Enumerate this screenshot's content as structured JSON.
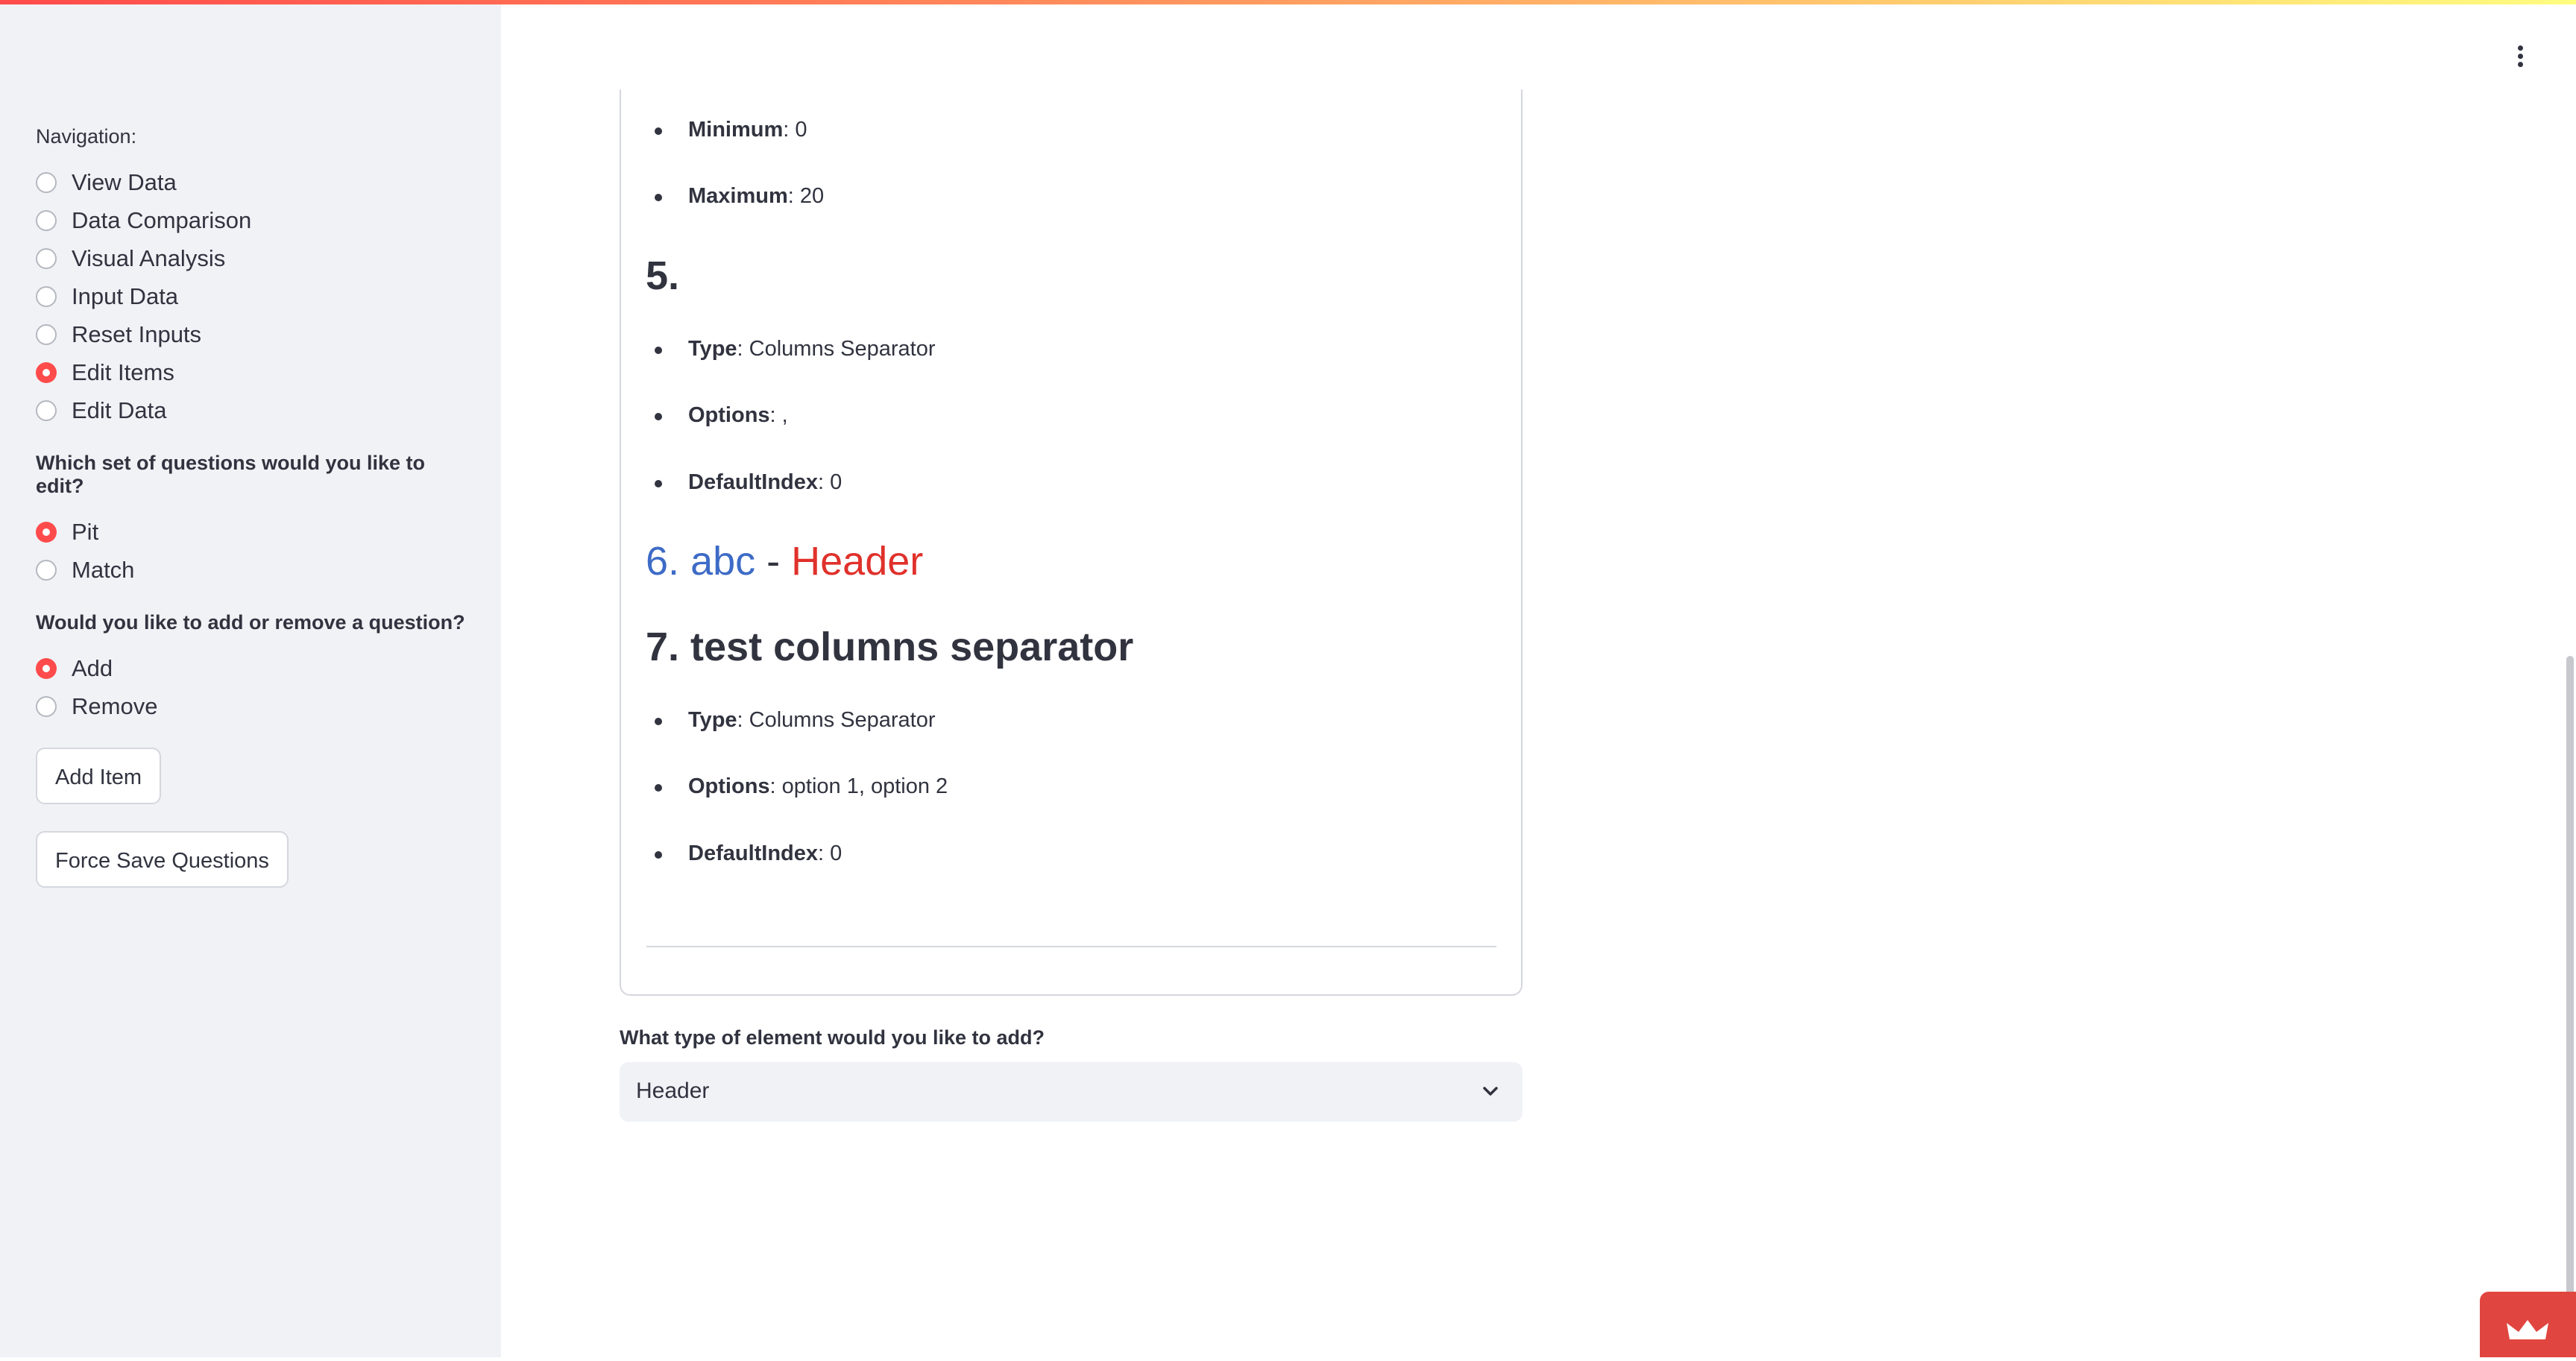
{
  "sidebar": {
    "nav_label": "Navigation:",
    "nav_items": [
      "View Data",
      "Data Comparison",
      "Visual Analysis",
      "Input Data",
      "Reset Inputs",
      "Edit Items",
      "Edit Data"
    ],
    "nav_selected": "Edit Items",
    "set_question": "Which set of questions would you like to edit?",
    "set_options": [
      "Pit",
      "Match"
    ],
    "set_selected": "Pit",
    "action_question": "Would you like to add or remove a question?",
    "action_options": [
      "Add",
      "Remove"
    ],
    "action_selected": "Add",
    "add_item_label": "Add Item",
    "force_save_label": "Force Save Questions"
  },
  "content": {
    "item4": {
      "min_key": "Minimum",
      "min_val": ": 0",
      "max_key": "Maximum",
      "max_val": ": 20"
    },
    "item5": {
      "heading": "5.",
      "type_key": "Type",
      "type_val": ": Columns Separator",
      "options_key": "Options",
      "options_val": ": ,",
      "default_key": "DefaultIndex",
      "default_val": ": 0"
    },
    "item6": {
      "num": "6.",
      "abc": "abc",
      "dash": " - ",
      "header": "Header"
    },
    "item7": {
      "heading": "7. test columns separator",
      "type_key": "Type",
      "type_val": ": Columns Separator",
      "options_key": "Options",
      "options_val": ": option 1, option 2",
      "default_key": "DefaultIndex",
      "default_val": ": 0"
    }
  },
  "element_select": {
    "label": "What type of element would you like to add?",
    "value": "Header"
  },
  "colors": {
    "accent": "#ff4b4b",
    "blue_text": "#3d6bc6",
    "red_text": "#e0312b"
  }
}
